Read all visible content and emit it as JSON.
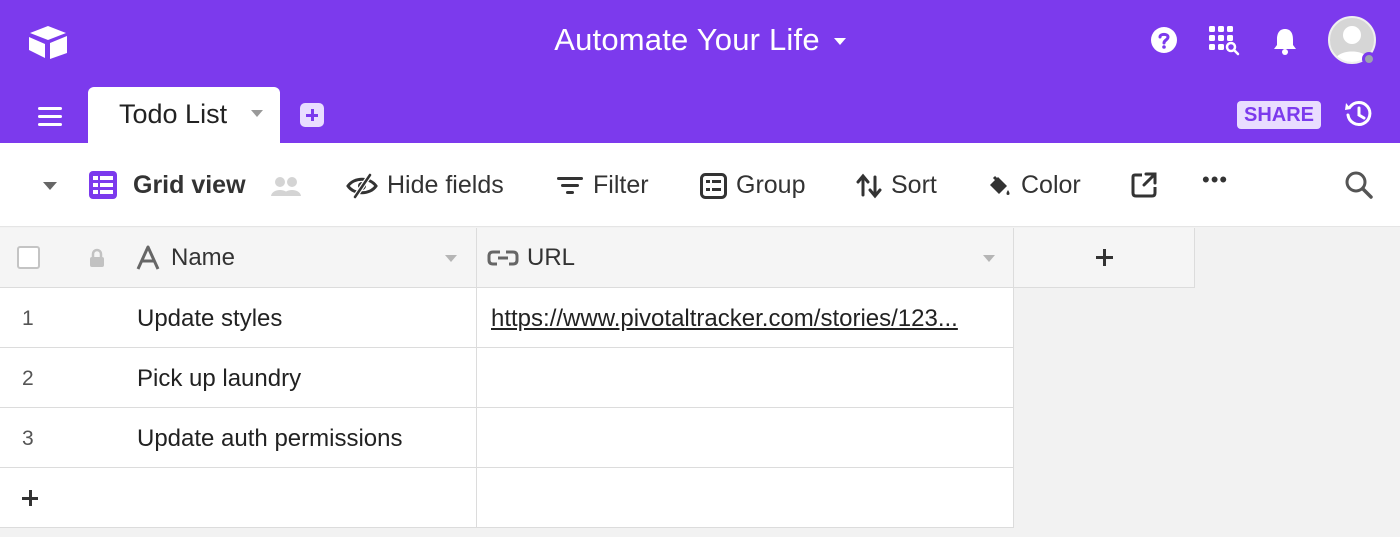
{
  "app": {
    "base_title": "Automate Your Life",
    "brand_color": "#7c3aed",
    "icons": {
      "logo": "airtable-logo-icon",
      "help": "help-circle-icon",
      "apps": "apps-grid-icon",
      "notifications": "bell-icon",
      "account": "avatar"
    }
  },
  "tabs": {
    "active_table": "Todo List",
    "share_label": "SHARE",
    "add_table_icon": "plus-square-icon",
    "history_icon": "history-icon"
  },
  "toolbar": {
    "view_name": "Grid view",
    "hide_fields": "Hide fields",
    "filter": "Filter",
    "group": "Group",
    "sort": "Sort",
    "color": "Color",
    "more": "•••"
  },
  "grid": {
    "columns": [
      {
        "label": "Name",
        "type": "text",
        "icon": "text-field-icon"
      },
      {
        "label": "URL",
        "type": "url",
        "icon": "link-field-icon"
      }
    ],
    "rows": [
      {
        "num": "1",
        "name": "Update styles",
        "url": "https://www.pivotaltracker.com/stories/123..."
      },
      {
        "num": "2",
        "name": "Pick up laundry",
        "url": ""
      },
      {
        "num": "3",
        "name": "Update auth permissions",
        "url": ""
      }
    ]
  }
}
